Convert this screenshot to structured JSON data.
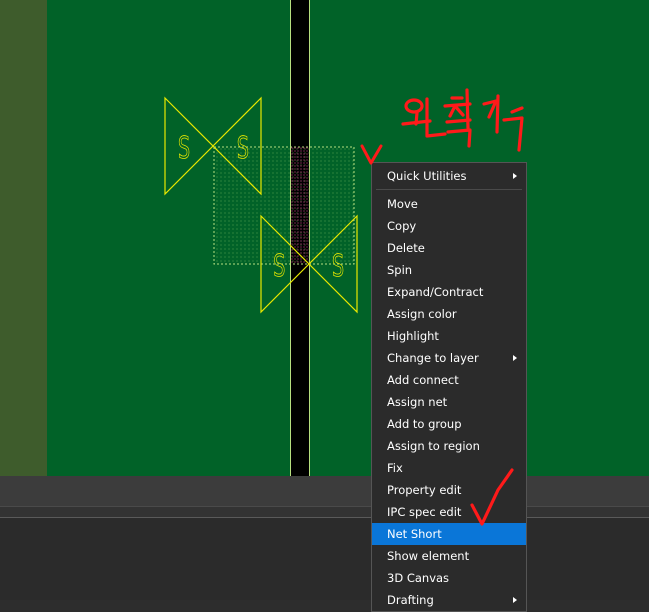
{
  "context_menu": {
    "items": [
      {
        "label": "Quick Utilities",
        "submenu": true
      },
      {
        "label": "Move",
        "submenu": false
      },
      {
        "label": "Copy",
        "submenu": false
      },
      {
        "label": "Delete",
        "submenu": false
      },
      {
        "label": "Spin",
        "submenu": false
      },
      {
        "label": "Expand/Contract",
        "submenu": false
      },
      {
        "label": "Assign color",
        "submenu": false
      },
      {
        "label": "Highlight",
        "submenu": false
      },
      {
        "label": "Change to layer",
        "submenu": true
      },
      {
        "label": "Add connect",
        "submenu": false
      },
      {
        "label": "Assign net",
        "submenu": false
      },
      {
        "label": "Add to group",
        "submenu": false
      },
      {
        "label": "Assign to region",
        "submenu": false
      },
      {
        "label": "Fix",
        "submenu": false
      },
      {
        "label": "Property edit",
        "submenu": false
      },
      {
        "label": "IPC spec edit",
        "submenu": false
      },
      {
        "label": "Net Short",
        "submenu": false,
        "highlighted": true
      },
      {
        "label": "Show element",
        "submenu": false
      },
      {
        "label": "3D Canvas",
        "submenu": false
      },
      {
        "label": "Drafting",
        "submenu": true
      }
    ]
  },
  "canvas": {
    "symbol_letter": "S",
    "colors": {
      "board": "#016228",
      "left_strip": "#3e5c2c",
      "trace": "#000000",
      "symbol": "#e8e800",
      "selection_box": "#b8e080"
    }
  },
  "annotations": {
    "handwritten_text": "우클릭",
    "color": "#ff1a1a"
  }
}
